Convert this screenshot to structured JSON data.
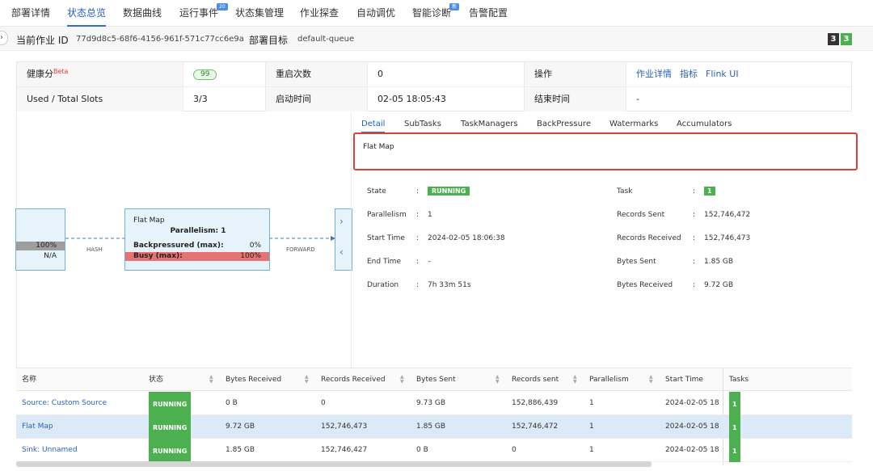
{
  "nav": {
    "tabs": [
      {
        "label": "部署详情"
      },
      {
        "label": "状态总览"
      },
      {
        "label": "数据曲线"
      },
      {
        "label": "运行事件",
        "badge": "20"
      },
      {
        "label": "状态集管理"
      },
      {
        "label": "作业探查"
      },
      {
        "label": "自动调优"
      },
      {
        "label": "智能诊断",
        "badge": "新"
      },
      {
        "label": "告警配置"
      }
    ],
    "active": "状态总览"
  },
  "job": {
    "id_label": "当前作业 ID",
    "id_value": "77d9d8c5-68f6-4156-961f-571c77cc6e9a",
    "target_label": "部署目标",
    "target_value": "default-queue",
    "counter_dark": "3",
    "counter_green": "3"
  },
  "info": {
    "health_label": "健康分",
    "health_beta": "Beta",
    "health_value": "99",
    "restart_label": "重启次数",
    "restart_value": "0",
    "ops_label": "操作",
    "ops_links": [
      "作业详情",
      "指标",
      "Flink UI"
    ],
    "slots_label": "Used / Total Slots",
    "slots_value": "3/3",
    "start_label": "启动时间",
    "start_value": "02-05 18:05:43",
    "end_label": "结束时间",
    "end_value": "-"
  },
  "graph": {
    "left_node": {
      "pct": "100%",
      "na": "N/A"
    },
    "edge1": "HASH",
    "edge2": "FORWARD",
    "center_node": {
      "name": "Flat Map",
      "parallelism": "Parallelism: 1",
      "bp_label": "Backpressured (max):",
      "bp_value": "0%",
      "busy_label": "Busy (max):",
      "busy_value": "100%"
    }
  },
  "detail": {
    "tabs": [
      "Detail",
      "SubTasks",
      "TaskManagers",
      "BackPressure",
      "Watermarks",
      "Accumulators"
    ],
    "active_tab": "Detail",
    "name": "Flat Map",
    "left": [
      {
        "label": "State",
        "value": "RUNNING"
      },
      {
        "label": "Parallelism",
        "value": "1"
      },
      {
        "label": "Start Time",
        "value": "2024-02-05 18:06:38"
      },
      {
        "label": "End Time",
        "value": "–"
      },
      {
        "label": "Duration",
        "value": "7h 33m 51s"
      }
    ],
    "right": [
      {
        "label": "Task",
        "value": "1"
      },
      {
        "label": "Records Sent",
        "value": "152,746,472"
      },
      {
        "label": "Records Received",
        "value": "152,746,473"
      },
      {
        "label": "Bytes Sent",
        "value": "1.85 GB"
      },
      {
        "label": "Bytes Received",
        "value": "9.72 GB"
      }
    ],
    "sep": ":"
  },
  "table": {
    "columns": [
      "名称",
      "状态",
      "Bytes Received",
      "Records Received",
      "Bytes Sent",
      "Records sent",
      "Parallelism",
      "Start Time",
      "Tasks"
    ],
    "rows": [
      [
        "Source: Custom Source",
        "RUNNING",
        "0 B",
        "0",
        "9.73 GB",
        "152,886,439",
        "1",
        "2024-02-05 18",
        "1"
      ],
      [
        "Flat Map",
        "RUNNING",
        "9.72 GB",
        "152,746,473",
        "1.85 GB",
        "152,746,472",
        "1",
        "2024-02-05 18",
        "1"
      ],
      [
        "Sink: Unnamed",
        "RUNNING",
        "1.85 GB",
        "152,746,427",
        "0 B",
        "0",
        "1",
        "2024-02-05 18",
        "1"
      ]
    ]
  },
  "colors": {
    "accent": "#2d6fd6",
    "running": "#4caf50",
    "busy": "#e57373",
    "highlight": "#d9413a"
  }
}
